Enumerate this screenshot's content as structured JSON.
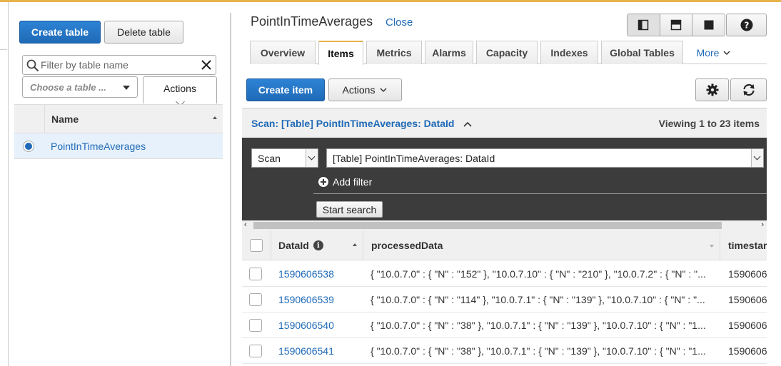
{
  "left_panel": {
    "create_table_label": "Create table",
    "delete_table_label": "Delete table",
    "filter_placeholder": "Filter by table name",
    "choose_table_label": "Choose a table ...",
    "actions_label": "Actions",
    "table": {
      "header": "Name",
      "rows": [
        {
          "name": "PointInTimeAverages",
          "selected": true
        }
      ]
    }
  },
  "right_panel": {
    "title": "PointInTimeAverages",
    "close_label": "Close",
    "view_icons": [
      "split-vertical-icon",
      "split-horizontal-icon",
      "fullscreen-icon"
    ],
    "help_icon": "help-icon",
    "tabs": [
      {
        "label": "Overview",
        "active": false
      },
      {
        "label": "Items",
        "active": true
      },
      {
        "label": "Metrics",
        "active": false
      },
      {
        "label": "Alarms",
        "active": false
      },
      {
        "label": "Capacity",
        "active": false
      },
      {
        "label": "Indexes",
        "active": false
      },
      {
        "label": "Global Tables",
        "active": false
      }
    ],
    "more_label": "More",
    "create_item_label": "Create item",
    "actions_label": "Actions",
    "scan": {
      "header_label": "Scan: [Table] PointInTimeAverages: DataId",
      "viewing_label": "Viewing 1 to 23 items",
      "mode_value": "Scan",
      "target_value": "[Table] PointInTimeAverages: DataId",
      "add_filter_label": "Add filter",
      "start_search_label": "Start search"
    },
    "items_table": {
      "columns": [
        "DataId",
        "processedData",
        "timestar"
      ],
      "rows": [
        {
          "data_id": "1590606538",
          "processed": "{ \"10.0.7.0\" : { \"N\" : \"152\" }, \"10.0.7.10\" : { \"N\" : \"210\" }, \"10.0.7.2\" : { \"N\" : \"...",
          "timestamp": "1590606"
        },
        {
          "data_id": "1590606539",
          "processed": "{ \"10.0.7.0\" : { \"N\" : \"114\" }, \"10.0.7.1\" : { \"N\" : \"139\" }, \"10.0.7.10\" : { \"N\" : \"...",
          "timestamp": "1590606"
        },
        {
          "data_id": "1590606540",
          "processed": "{ \"10.0.7.0\" : { \"N\" : \"38\" }, \"10.0.7.1\" : { \"N\" : \"139\" }, \"10.0.7.10\" : { \"N\" : \"1...",
          "timestamp": "1590606"
        },
        {
          "data_id": "1590606541",
          "processed": "{ \"10.0.7.0\" : { \"N\" : \"38\" }, \"10.0.7.1\" : { \"N\" : \"139\" }, \"10.0.7.10\" : { \"N\" : \"1...",
          "timestamp": "1590606"
        }
      ]
    }
  },
  "colors": {
    "primary": "#1f6ab7",
    "accent": "#e7b34a",
    "dark_panel": "#3c3c3c",
    "selected_row": "#e6f1fb"
  }
}
